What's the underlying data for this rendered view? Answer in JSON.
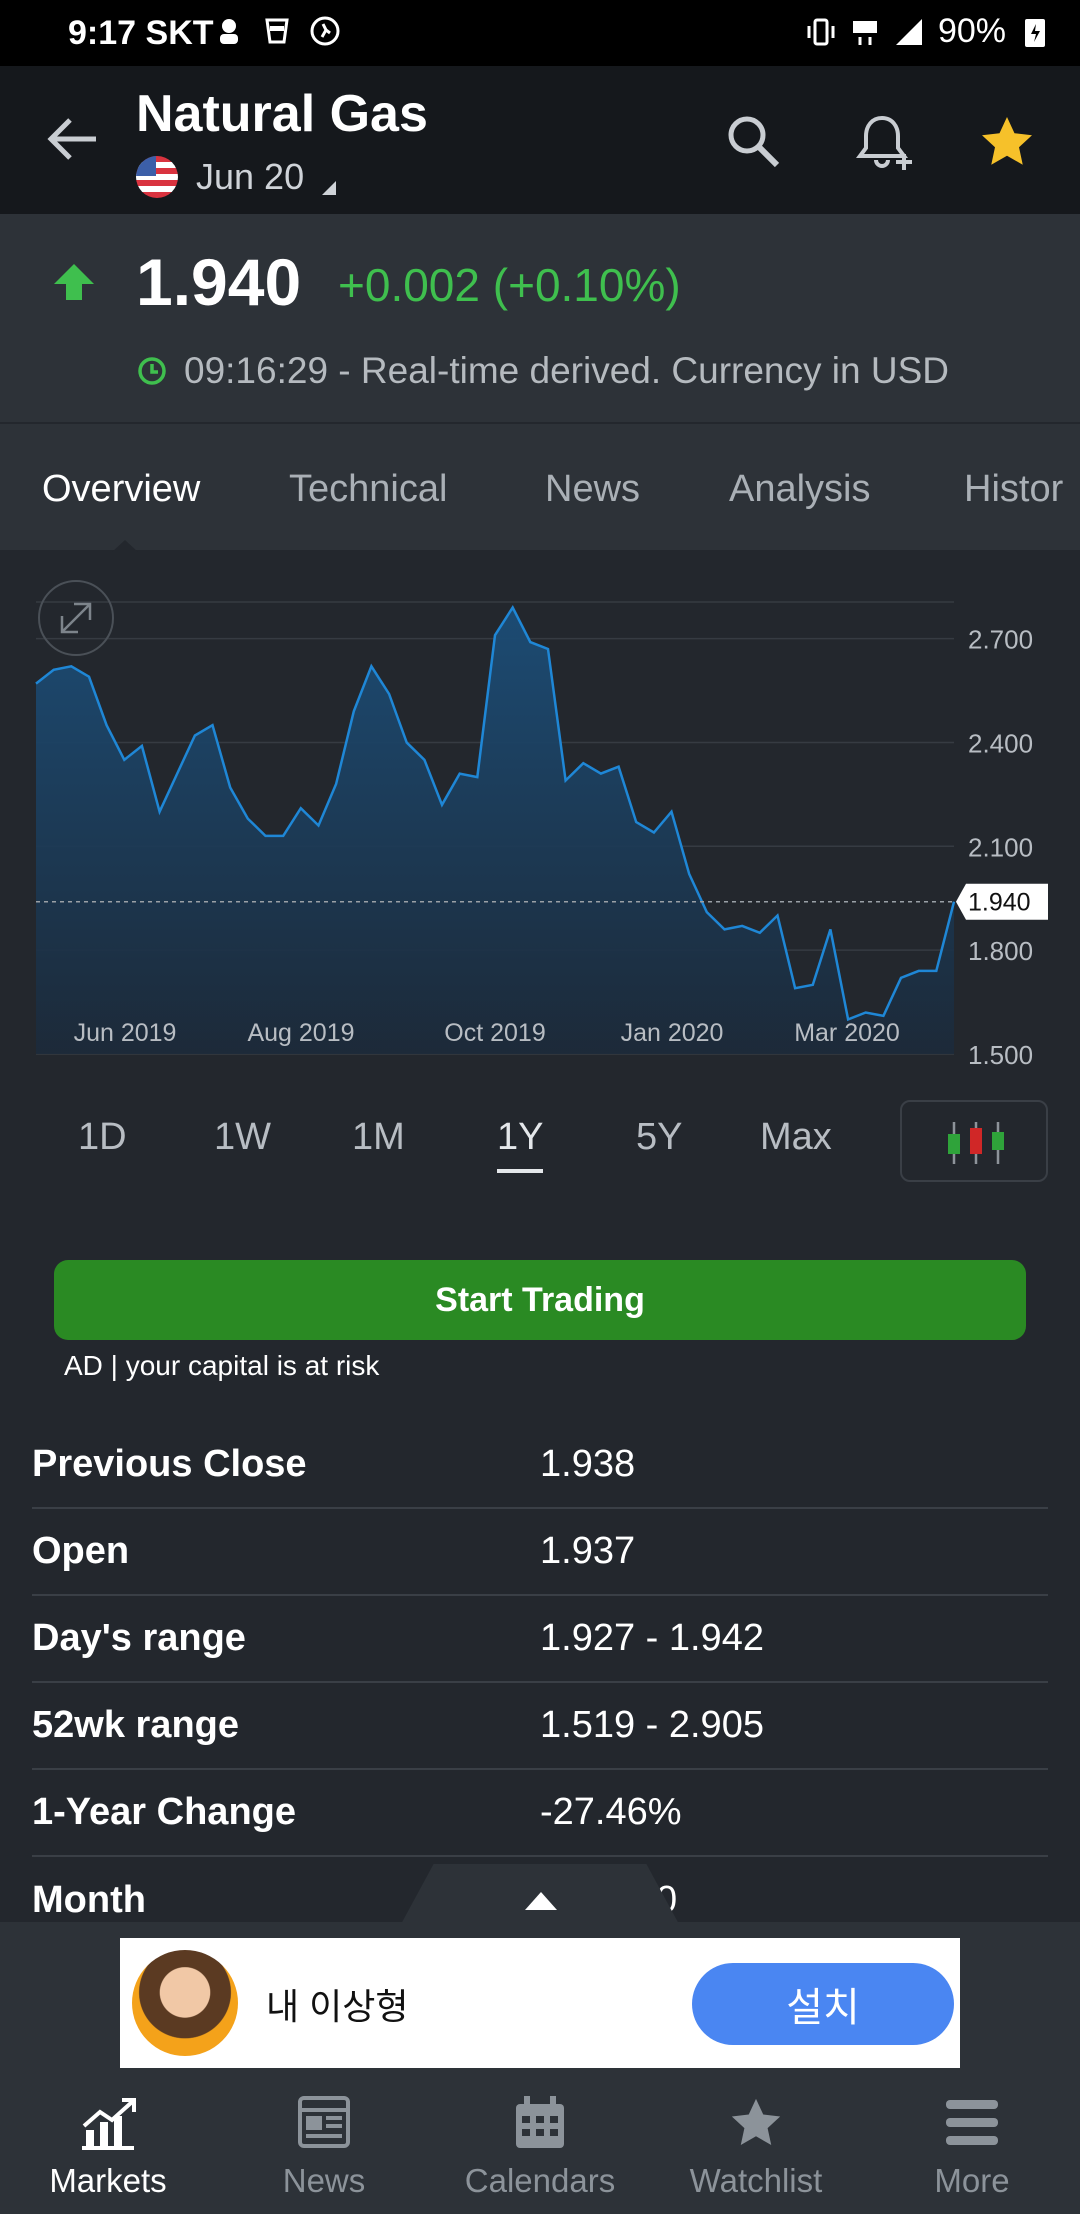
{
  "status": {
    "time": "9:17",
    "carrier": "SKT",
    "battery": "90%"
  },
  "header": {
    "title": "Natural Gas",
    "contract": "Jun 20"
  },
  "quote": {
    "price": "1.940",
    "change": "+0.002 (+0.10%)",
    "meta": "09:16:29 - Real-time derived. Currency in USD",
    "direction": "up"
  },
  "tabs": [
    "Overview",
    "Technical",
    "News",
    "Analysis",
    "Histor"
  ],
  "active_tab": "Overview",
  "chart_data": {
    "type": "area",
    "x_ticks": [
      "Jun 2019",
      "Aug 2019",
      "Oct 2019",
      "Jan 2020",
      "Mar 2020"
    ],
    "y_ticks": [
      "2.700",
      "2.400",
      "2.100",
      "1.800",
      "1.500"
    ],
    "ylim": [
      1.5,
      2.8
    ],
    "last_price_label": "1.940",
    "values": [
      2.57,
      2.61,
      2.62,
      2.59,
      2.45,
      2.35,
      2.39,
      2.2,
      2.31,
      2.42,
      2.45,
      2.27,
      2.18,
      2.13,
      2.13,
      2.21,
      2.16,
      2.28,
      2.49,
      2.62,
      2.54,
      2.4,
      2.35,
      2.22,
      2.31,
      2.3,
      2.71,
      2.79,
      2.69,
      2.67,
      2.29,
      2.34,
      2.31,
      2.33,
      2.17,
      2.14,
      2.2,
      2.02,
      1.91,
      1.86,
      1.87,
      1.85,
      1.9,
      1.69,
      1.7,
      1.86,
      1.6,
      1.62,
      1.61,
      1.72,
      1.74,
      1.74,
      1.94
    ],
    "line_color": "#1f87d6",
    "grid": true
  },
  "ranges": [
    "1D",
    "1W",
    "1M",
    "1Y",
    "5Y",
    "Max"
  ],
  "active_range": "1Y",
  "trade": {
    "button": "Start Trading",
    "note": "AD | your capital is at risk"
  },
  "stats": [
    {
      "label": "Previous Close",
      "value": "1.938"
    },
    {
      "label": "Open",
      "value": "1.937"
    },
    {
      "label": "Day's range",
      "value": "1.927 - 1.942"
    },
    {
      "label": "52wk range",
      "value": "1.519 - 2.905"
    },
    {
      "label": "1-Year Change",
      "value": "-27.46%"
    },
    {
      "label": "Month",
      "value": "0"
    }
  ],
  "ad": {
    "text": "내 이상형",
    "button": "설치"
  },
  "nav": [
    {
      "label": "Markets",
      "icon": "markets-icon"
    },
    {
      "label": "News",
      "icon": "news-icon"
    },
    {
      "label": "Calendars",
      "icon": "calendar-icon"
    },
    {
      "label": "Watchlist",
      "icon": "star-icon"
    },
    {
      "label": "More",
      "icon": "menu-icon"
    }
  ],
  "colors": {
    "up": "#3fbf4e",
    "trade_button": "#2a8a23",
    "star": "#f6c12a",
    "ad_install": "#4a86f2"
  }
}
